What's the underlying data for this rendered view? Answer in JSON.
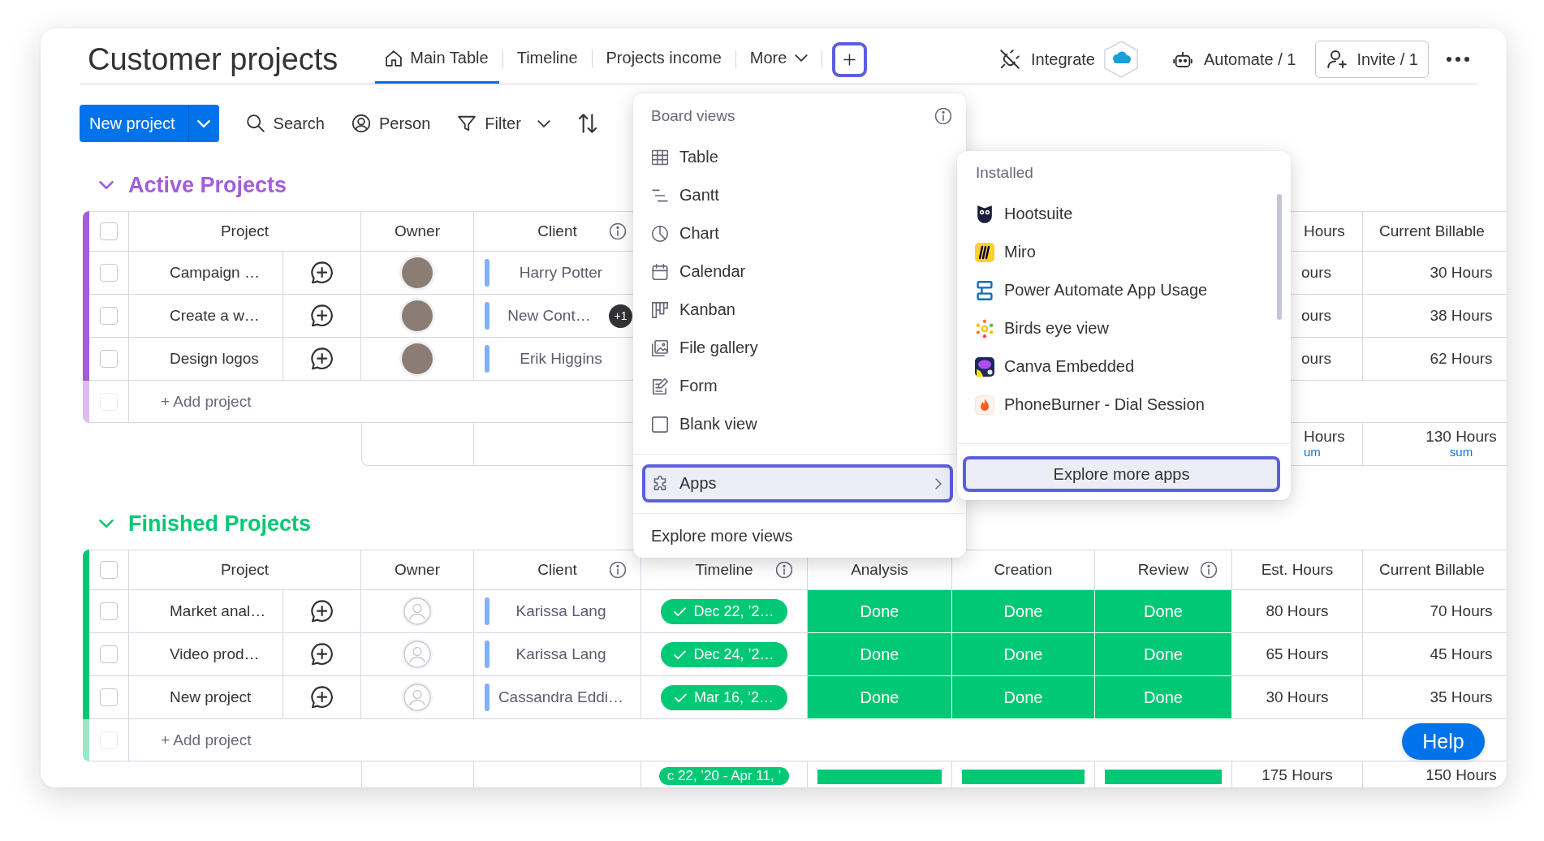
{
  "board": {
    "title": "Customer projects"
  },
  "view_tabs": [
    {
      "kind": "home",
      "label": "Main Table",
      "selected": true
    },
    {
      "kind": "plain",
      "label": "Timeline",
      "selected": false
    },
    {
      "kind": "plain",
      "label": "Projects income",
      "selected": false
    },
    {
      "kind": "dropdown",
      "label": "More",
      "selected": false
    }
  ],
  "add_view_button": {
    "highlighted": true
  },
  "header_actions": [
    {
      "kind": "integrate",
      "label": "Integrate"
    },
    {
      "kind": "automate",
      "label": "Automate / 1"
    },
    {
      "kind": "invite",
      "label": "Invite / 1"
    },
    {
      "kind": "more"
    }
  ],
  "toolbar": {
    "new_button": {
      "label": "New project"
    },
    "items": [
      {
        "kind": "search",
        "label": "Search"
      },
      {
        "kind": "person",
        "label": "Person"
      },
      {
        "kind": "filter",
        "label": "Filter"
      },
      {
        "kind": "sort"
      }
    ]
  },
  "groups": [
    {
      "kind": "under_menu",
      "title": "Active Projects",
      "color": "#a25ddc",
      "expanded": true,
      "header_checked": false,
      "columns": {
        "project": {
          "label": "Project"
        },
        "owner": {
          "label": "Owner"
        },
        "client": {
          "label": "Client",
          "info": true
        },
        "est_hours": {
          "label": "Hours"
        },
        "billable": {
          "label": "Current Billable"
        }
      },
      "rows": [
        {
          "checked": false,
          "project": "Campaign …",
          "owner": {
            "kind": "photo"
          },
          "client": {
            "name": "Harry Potter"
          },
          "est_hours": "ours",
          "billable": "30 Hours"
        },
        {
          "checked": false,
          "project": "Create a w…",
          "owner": {
            "kind": "photo"
          },
          "client": {
            "name": "New Cont…",
            "extra": "+1"
          },
          "est_hours": "ours",
          "billable": "38 Hours"
        },
        {
          "checked": false,
          "project": "Design logos",
          "owner": {
            "kind": "photo"
          },
          "client": {
            "name": "Erik Higgins"
          },
          "est_hours": "ours",
          "billable": "62 Hours"
        }
      ],
      "add_row": {
        "placeholder": "+ Add project",
        "checkbox_disabled": true
      },
      "summary": {
        "est_hours": {
          "value": "Hours",
          "caption": "um"
        },
        "billable": {
          "value": "130 Hours",
          "caption": "sum"
        }
      }
    },
    {
      "kind": "open",
      "title": "Finished Projects",
      "color": "#00c875",
      "expanded": true,
      "header_checked": false,
      "columns": {
        "project": {
          "label": "Project"
        },
        "owner": {
          "label": "Owner"
        },
        "client": {
          "label": "Client",
          "info": true
        },
        "timeline": {
          "label": "Timeline",
          "info": true
        },
        "analysis": {
          "label": "Analysis"
        },
        "creation": {
          "label": "Creation"
        },
        "review": {
          "label": "Review",
          "info": true
        },
        "est_hours": {
          "label": "Est. Hours"
        },
        "billable": {
          "label": "Current Billable"
        }
      },
      "rows": [
        {
          "checked": false,
          "project": "Market anal…",
          "owner": {
            "kind": "empty"
          },
          "client": {
            "name": "Karissa Lang"
          },
          "timeline": {
            "label": "Dec 22, ’2…",
            "done": true
          },
          "analysis": {
            "label": "Done",
            "color": "#00c875"
          },
          "creation": {
            "label": "Done",
            "color": "#00c875"
          },
          "review": {
            "label": "Done",
            "color": "#00c875"
          },
          "est_hours": "80 Hours",
          "billable": "70 Hours"
        },
        {
          "checked": false,
          "project": "Video prod…",
          "owner": {
            "kind": "empty"
          },
          "client": {
            "name": "Karissa Lang"
          },
          "timeline": {
            "label": "Dec 24, ’2…",
            "done": true
          },
          "analysis": {
            "label": "Done",
            "color": "#00c875"
          },
          "creation": {
            "label": "Done",
            "color": "#00c875"
          },
          "review": {
            "label": "Done",
            "color": "#00c875"
          },
          "est_hours": "65 Hours",
          "billable": "45 Hours"
        },
        {
          "checked": false,
          "project": "New project",
          "owner": {
            "kind": "empty"
          },
          "client": {
            "name": "Cassandra Eddi…"
          },
          "timeline": {
            "label": "Mar 16, ’2…",
            "done": true
          },
          "analysis": {
            "label": "Done",
            "color": "#00c875"
          },
          "creation": {
            "label": "Done",
            "color": "#00c875"
          },
          "review": {
            "label": "Done",
            "color": "#00c875"
          },
          "est_hours": "30 Hours",
          "billable": "35 Hours"
        }
      ],
      "add_row": {
        "placeholder": "+ Add project",
        "checkbox_disabled": true
      },
      "summary": {
        "timeline": {
          "label": "c 22, ’20 - Apr 11, ’"
        },
        "analysis": {
          "level": 1,
          "color": "#00c875"
        },
        "creation": {
          "level": 1,
          "color": "#00c875"
        },
        "review": {
          "level": 1,
          "color": "#00c875"
        },
        "est_hours": {
          "value": "175 Hours"
        },
        "billable": {
          "value": "150 Hours"
        }
      }
    }
  ],
  "board_views_menu": {
    "title": "Board views",
    "info": true,
    "items": [
      {
        "kind": "table",
        "label": "Table"
      },
      {
        "kind": "gantt",
        "label": "Gantt"
      },
      {
        "kind": "chart",
        "label": "Chart"
      },
      {
        "kind": "calendar",
        "label": "Calendar"
      },
      {
        "kind": "kanban",
        "label": "Kanban"
      },
      {
        "kind": "gallery",
        "label": "File gallery"
      },
      {
        "kind": "form",
        "label": "Form"
      },
      {
        "kind": "blank",
        "label": "Blank view"
      }
    ],
    "apps_item": {
      "label": "Apps",
      "selected": true,
      "highlighted": true
    },
    "footer_link": "Explore more views"
  },
  "apps_submenu": {
    "title": "Installed",
    "items": [
      {
        "kind": "owl",
        "label": "Hootsuite"
      },
      {
        "kind": "tile_m",
        "label": "Miro"
      },
      {
        "kind": "flow",
        "label": "Power Automate App Usage"
      },
      {
        "kind": "burst",
        "label": "Birds eye view"
      },
      {
        "kind": "canvas_tile",
        "label": "Canva Embedded"
      },
      {
        "kind": "flame",
        "label": "PhoneBurner - Dial Session"
      }
    ],
    "button": {
      "label": "Explore more apps",
      "highlighted": true
    }
  },
  "help_button": {
    "label": "Help"
  }
}
